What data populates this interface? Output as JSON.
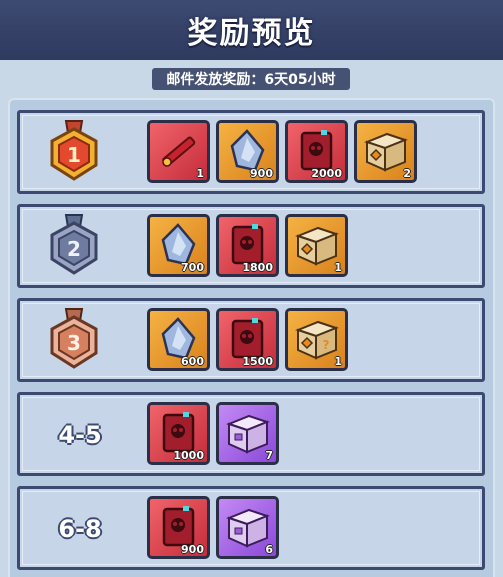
{
  "header": {
    "title": "奖励预览"
  },
  "subtitle": "邮件发放奖励：6天05小时",
  "colors": {
    "header_bg": "#2e3a5e",
    "panel_bg": "#b7cbe0",
    "border": "#3c4a72"
  },
  "rows": [
    {
      "rank": "1",
      "medal": "gold-medal-icon",
      "items": [
        {
          "icon": "scroll-icon",
          "color": "red",
          "qty": "1"
        },
        {
          "icon": "crystal-icon",
          "color": "orange",
          "qty": "900"
        },
        {
          "icon": "skull-book-icon",
          "color": "red",
          "qty": "2000"
        },
        {
          "icon": "gold-chest-icon",
          "color": "orange",
          "qty": "2"
        }
      ]
    },
    {
      "rank": "2",
      "medal": "silver-medal-icon",
      "items": [
        {
          "icon": "crystal-icon",
          "color": "orange",
          "qty": "700"
        },
        {
          "icon": "skull-book-icon",
          "color": "red",
          "qty": "1800"
        },
        {
          "icon": "gold-chest-icon",
          "color": "orange",
          "qty": "1"
        }
      ]
    },
    {
      "rank": "3",
      "medal": "bronze-medal-icon",
      "items": [
        {
          "icon": "crystal-icon",
          "color": "orange",
          "qty": "600"
        },
        {
          "icon": "skull-book-icon",
          "color": "red",
          "qty": "1500"
        },
        {
          "icon": "mystery-chest-icon",
          "color": "orange",
          "qty": "1"
        }
      ]
    },
    {
      "rank": "4-5",
      "items": [
        {
          "icon": "skull-book-icon",
          "color": "red",
          "qty": "1000"
        },
        {
          "icon": "purple-chest-icon",
          "color": "purple",
          "qty": "7"
        }
      ]
    },
    {
      "rank": "6-8",
      "items": [
        {
          "icon": "skull-book-icon",
          "color": "red",
          "qty": "900"
        },
        {
          "icon": "purple-chest-icon",
          "color": "purple",
          "qty": "6"
        }
      ]
    }
  ]
}
